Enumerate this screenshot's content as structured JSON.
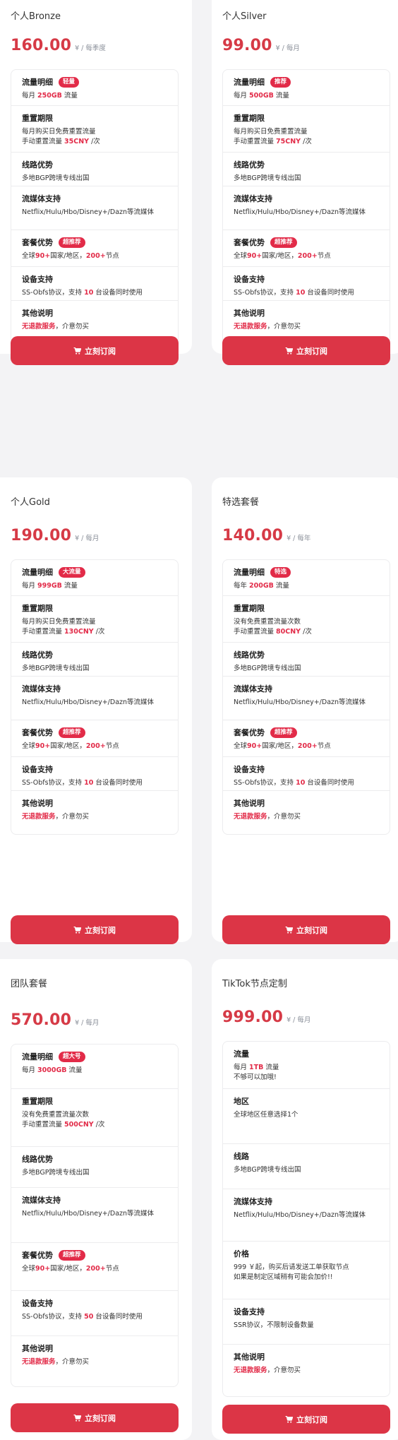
{
  "accent_color": "#dc3546",
  "badge_color": "#e22b48",
  "cards": [
    {
      "title": "个人Bronze",
      "price": "160.00",
      "unit": "¥ / 每季度",
      "button": "立刻订阅",
      "features": [
        {
          "title": "流量明细",
          "badge": "轻量",
          "body": [
            "每月 <span class=\"hl\">250GB</span> 流量"
          ]
        },
        {
          "title": "重置期限",
          "body": [
            "每月购买日免费重置流量",
            "手动重置流量 <span class=\"hl\">35CNY</span> /次"
          ]
        },
        {
          "title": "线路优势",
          "body": [
            "多地BGP跨境专线出国"
          ]
        },
        {
          "title": "流媒体支持",
          "body": [
            "Netflix/Hulu/Hbo/Disney+/Dazn等流媒体"
          ]
        },
        {
          "title": "套餐优势",
          "badge": "超推荐",
          "body": [
            "全球<span class=\"hl\">90+</span>国家/地区，<span class=\"hl\">200+</span>节点"
          ]
        },
        {
          "title": "设备支持",
          "body": [
            "SS-Obfs协议，支持 <span class=\"hl\">10</span> 台设备同时使用"
          ]
        },
        {
          "title": "其他说明",
          "body": [
            "<span class=\"hl\">无退款服务</span>，介意勿买"
          ]
        }
      ]
    },
    {
      "title": "个人Silver",
      "price": "99.00",
      "unit": "¥ / 每月",
      "button": "立刻订阅",
      "features": [
        {
          "title": "流量明细",
          "badge": "推荐",
          "body": [
            "每月 <span class=\"hl\">500GB</span> 流量"
          ]
        },
        {
          "title": "重置期限",
          "body": [
            "每月购买日免费重置流量",
            "手动重置流量 <span class=\"hl\">75CNY</span> /次"
          ]
        },
        {
          "title": "线路优势",
          "body": [
            "多地BGP跨境专线出国"
          ]
        },
        {
          "title": "流媒体支持",
          "body": [
            "Netflix/Hulu/Hbo/Disney+/Dazn等流媒体"
          ]
        },
        {
          "title": "套餐优势",
          "badge": "超推荐",
          "body": [
            "全球<span class=\"hl\">90+</span>国家/地区，<span class=\"hl\">200+</span>节点"
          ]
        },
        {
          "title": "设备支持",
          "body": [
            "SS-Obfs协议，支持 <span class=\"hl\">10</span> 台设备同时使用"
          ]
        },
        {
          "title": "其他说明",
          "body": [
            "<span class=\"hl\">无退款服务</span>，介意勿买"
          ]
        }
      ]
    },
    {
      "title": "个人Gold",
      "price": "190.00",
      "unit": "¥ / 每月",
      "button": "立刻订阅",
      "features": [
        {
          "title": "流量明细",
          "badge": "大流量",
          "body": [
            "每月 <span class=\"hl\">999GB</span> 流量"
          ]
        },
        {
          "title": "重置期限",
          "body": [
            "每月购买日免费重置流量",
            "手动重置流量 <span class=\"hl\">130CNY</span> /次"
          ]
        },
        {
          "title": "线路优势",
          "body": [
            "多地BGP跨境专线出国"
          ]
        },
        {
          "title": "流媒体支持",
          "body": [
            "Netflix/Hulu/Hbo/Disney+/Dazn等流媒体"
          ]
        },
        {
          "title": "套餐优势",
          "badge": "超推荐",
          "body": [
            "全球<span class=\"hl\">90+</span>国家/地区，<span class=\"hl\">200+</span>节点"
          ]
        },
        {
          "title": "设备支持",
          "body": [
            "SS-Obfs协议，支持 <span class=\"hl\">10</span> 台设备同时使用"
          ]
        },
        {
          "title": "其他说明",
          "body": [
            "<span class=\"hl\">无退款服务</span>，介意勿买"
          ]
        }
      ]
    },
    {
      "title": "特选套餐",
      "price": "140.00",
      "unit": "¥ / 每年",
      "button": "立刻订阅",
      "features": [
        {
          "title": "流量明细",
          "badge": "特选",
          "body": [
            "每年 <span class=\"hl\">200GB</span> 流量"
          ]
        },
        {
          "title": "重置期限",
          "body": [
            "没有免费重置流量次数",
            "手动重置流量 <span class=\"hl\">80CNY</span> /次"
          ]
        },
        {
          "title": "线路优势",
          "body": [
            "多地BGP跨境专线出国"
          ]
        },
        {
          "title": "流媒体支持",
          "body": [
            "Netflix/Hulu/Hbo/Disney+/Dazn等流媒体"
          ]
        },
        {
          "title": "套餐优势",
          "badge": "超推荐",
          "body": [
            "全球<span class=\"hl\">90+</span>国家/地区，<span class=\"hl\">200+</span>节点"
          ]
        },
        {
          "title": "设备支持",
          "body": [
            "SS-Obfs协议，支持 <span class=\"hl\">10</span> 台设备同时使用"
          ]
        },
        {
          "title": "其他说明",
          "body": [
            "<span class=\"hl\">无退款服务</span>，介意勿买"
          ]
        }
      ]
    },
    {
      "title": "团队套餐",
      "price": "570.00",
      "unit": "¥ / 每月",
      "button": "立刻订阅",
      "features": [
        {
          "title": "流量明细",
          "badge": "超大号",
          "body": [
            "每月 <span class=\"hl\">3000GB</span> 流量"
          ]
        },
        {
          "title": "重置期限",
          "body": [
            "没有免费重置流量次数",
            "手动重置流量 <span class=\"hl\">500CNY</span> /次"
          ]
        },
        {
          "title": "线路优势",
          "body": [
            "多地BGP跨境专线出国"
          ]
        },
        {
          "title": "流媒体支持",
          "body": [
            "Netflix/Hulu/Hbo/Disney+/Dazn等流媒体"
          ]
        },
        {
          "title": "套餐优势",
          "badge": "超推荐",
          "body": [
            "全球<span class=\"hl\">90+</span>国家/地区，<span class=\"hl\">200+</span>节点"
          ]
        },
        {
          "title": "设备支持",
          "body": [
            "SS-Obfs协议，支持 <span class=\"hl\">50</span> 台设备同时使用"
          ]
        },
        {
          "title": "其他说明",
          "body": [
            "<span class=\"hl\">无退款服务</span>，介意勿买"
          ]
        }
      ]
    },
    {
      "title": "TikTok节点定制",
      "price": "999.00",
      "unit": "¥ / 每月",
      "button": "立刻订阅",
      "features": [
        {
          "title": "流量",
          "body": [
            "每月 <span class=\"hl\">1TB</span> 流量",
            "不够可以加哦!"
          ]
        },
        {
          "title": "地区",
          "body": [
            "全球地区任意选择1个"
          ]
        },
        {
          "title": "线路",
          "body": [
            "多地BGP跨境专线出国"
          ]
        },
        {
          "title": "流媒体支持",
          "body": [
            "Netflix/Hulu/Hbo/Disney+/Dazn等流媒体"
          ]
        },
        {
          "title": "价格",
          "body": [
            "999 ￥起，购买后请发送工单获取节点",
            "如果是制定区域稍有可能会加价!!"
          ]
        },
        {
          "title": "设备支持",
          "body": [
            "SSR协议，不限制设备数量"
          ]
        },
        {
          "title": "其他说明",
          "body": [
            "<span class=\"hl\">无退款服务</span>，介意勿买"
          ]
        }
      ]
    }
  ]
}
